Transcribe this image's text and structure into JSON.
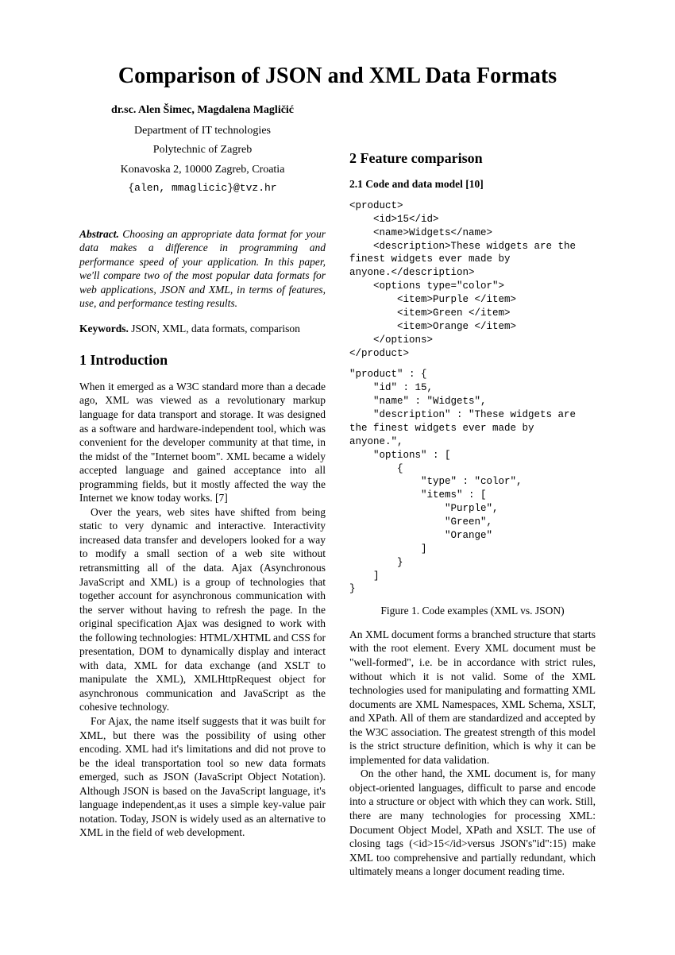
{
  "title": "Comparison of JSON and XML Data Formats",
  "authors": "dr.sc. Alen Šimec, Magdalena Magličić",
  "affil1": "Department of  IT technologies",
  "affil2": "Polytechnic of Zagreb",
  "affil3": "Konavoska 2, 10000 Zagreb, Croatia",
  "email": "{alen, mmaglicic}@tvz.hr",
  "abstract_label": "Abstract.",
  "abstract": "Choosing an appropriate data format for your data makes a difference in programming and performance speed of your application. In this paper, we'll compare two of the most popular data formats for web applications, JSON and XML, in terms of features, use, and performance testing results.",
  "keywords_label": "Keywords.",
  "keywords": "JSON, XML, data formats, comparison",
  "section1_heading": "1 Introduction",
  "intro_p1": "When it emerged as a W3C standard more than a decade ago, XML was viewed as a revolutionary markup language for data transport and storage. It was designed as a software and hardware-independent tool, which was convenient for the developer community at that time, in the midst of the \"Internet boom\". XML became a widely accepted language and gained acceptance into all programming fields, but it mostly affected the way the Internet we know today works. [7]",
  "intro_p2": "Over the years, web sites have shifted from being static to very dynamic and interactive. Interactivity increased data transfer and developers looked for a way to modify a small section of a web site without retransmitting all of the data. Ajax (Asynchronous JavaScript and XML) is a group of technologies that together account for asynchronous communication with the server without having to refresh the page. In the original specification Ajax was designed to work with the following technologies: HTML/XHTML and CSS for presentation, DOM to dynamically display and interact with data, XML for data exchange (and XSLT to manipulate the XML), XMLHttpRequest object for asynchronous communication and JavaScript as the cohesive technology.",
  "intro_p3": "For Ajax, the name itself suggests that it was built for XML, but there was the possibility of using other encoding. XML had it's limitations and did not prove to be the ideal transportation tool so new data formats emerged, such as JSON (JavaScript Object Notation). Although JSON is based on the JavaScript language, it's language independent,as it uses a simple key-value pair notation. Today, JSON is widely used as an alternative to XML in the field of web development.",
  "section2_heading": "2 Feature comparison",
  "subsection21_heading": "2.1 Code and data model [10]",
  "code_xml": "<product>\n    <id>15</id>\n    <name>Widgets</name>\n    <description>These widgets are the\nfinest widgets ever made by\nanyone.</description>\n    <options type=\"color\">\n        <item>Purple </item>\n        <item>Green </item>\n        <item>Orange </item>\n    </options>\n</product>",
  "code_json": "\"product\" : {\n    \"id\" : 15,\n    \"name\" : \"Widgets\",\n    \"description\" : \"These widgets are\nthe finest widgets ever made by\nanyone.\",\n    \"options\" : [\n        {\n            \"type\" : \"color\",\n            \"items\" : [\n                \"Purple\",\n                \"Green\",\n                \"Orange\"\n            ]\n        }\n    ]\n}",
  "figure1_caption": "Figure 1. Code examples (XML vs. JSON)",
  "body2_p1": "An XML document forms a branched structure that starts with the root element. Every XML document must be \"well-formed\", i.e. be in accordance with strict rules, without which it is not valid. Some of the XML technologies used for manipulating and formatting XML documents are XML Namespaces, XML Schema, XSLT, and XPath. All of them are standardized and accepted by the W3C association. The greatest strength of this model is the strict structure definition, which is why it can be implemented for data validation.",
  "body2_p2": "On the other hand, the XML document is, for many object-oriented languages, difficult to parse and encode into a structure or object with which they can work. Still, there are many technologies for processing XML: Document Object Model, XPath and XSLT. The use of closing tags (<id>15</id>versus JSON's\"id\":15) make XML too comprehensive and partially redundant, which ultimately means a longer document reading time."
}
